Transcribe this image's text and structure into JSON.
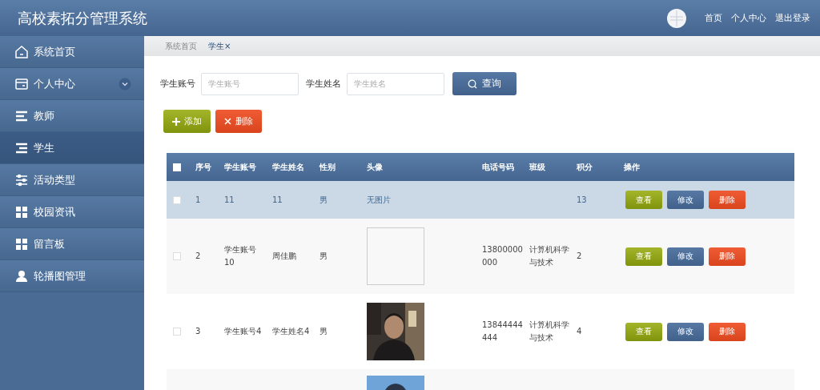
{
  "header": {
    "title": "高校素拓分管理系统",
    "links": [
      "首页",
      "个人中心",
      "退出登录"
    ]
  },
  "sidebar": {
    "items": [
      {
        "label": "系统首页",
        "selected": false
      },
      {
        "label": "个人中心",
        "selected": false,
        "expanded": false
      },
      {
        "label": "教师",
        "selected": false
      },
      {
        "label": "学生",
        "selected": true
      },
      {
        "label": "活动类型",
        "selected": false
      },
      {
        "label": "校园资讯",
        "selected": false
      },
      {
        "label": "留言板",
        "selected": false
      },
      {
        "label": "轮播图管理",
        "selected": false
      }
    ]
  },
  "breadcrumb": [
    {
      "label": "系统首页",
      "selected": false
    },
    {
      "label": "学生",
      "selected": true,
      "close": "×"
    }
  ],
  "search": {
    "fields": [
      {
        "label": "学生账号",
        "placeholder": "学生账号"
      },
      {
        "label": "学生姓名",
        "placeholder": "学生姓名"
      }
    ],
    "button": "查询"
  },
  "actions": [
    {
      "label": "添加",
      "kind": "add"
    },
    {
      "label": "删除",
      "kind": "delete"
    }
  ],
  "table": {
    "all_checked": false,
    "columns": [
      "序号",
      "学生账号",
      "学生姓名",
      "性别",
      "头像",
      "电话号码",
      "班级",
      "积分",
      "操作"
    ],
    "rows": [
      {
        "kind": "full",
        "selected": true,
        "checked": false,
        "cells": [
          "1",
          "11",
          "11",
          "男"
        ],
        "avatar": {
          "kind": "text",
          "text": "无图片"
        },
        "phone": "",
        "class": "",
        "score": "13",
        "buttons": [
          {
            "label": "查看",
            "kind": "view"
          },
          {
            "label": "修改",
            "kind": "edit"
          },
          {
            "label": "删除",
            "kind": "delete"
          }
        ]
      },
      {
        "kind": "full",
        "selected": false,
        "checked": false,
        "cells": [
          "2",
          "学生账号10",
          "周佳鹏",
          "男"
        ],
        "avatar": {
          "kind": "broken"
        },
        "phone": "13800000000",
        "class": "计算机科学与技术",
        "score": "2",
        "buttons": [
          {
            "label": "查看",
            "kind": "view"
          },
          {
            "label": "修改",
            "kind": "edit"
          },
          {
            "label": "删除",
            "kind": "delete"
          }
        ]
      },
      {
        "kind": "full",
        "selected": false,
        "checked": false,
        "cells": [
          "3",
          "学生账号4",
          "学生姓名4",
          "男"
        ],
        "avatar": {
          "kind": "picture"
        },
        "phone": "13844444444",
        "class": "计算机科学与技术",
        "score": "4",
        "buttons": [
          {
            "label": "查看",
            "kind": "view"
          },
          {
            "label": "修改",
            "kind": "edit"
          },
          {
            "label": "删除",
            "kind": "delete"
          }
        ]
      },
      {
        "kind": "partial",
        "selected": false,
        "avatar": {
          "kind": "picture-sky"
        }
      }
    ]
  }
}
